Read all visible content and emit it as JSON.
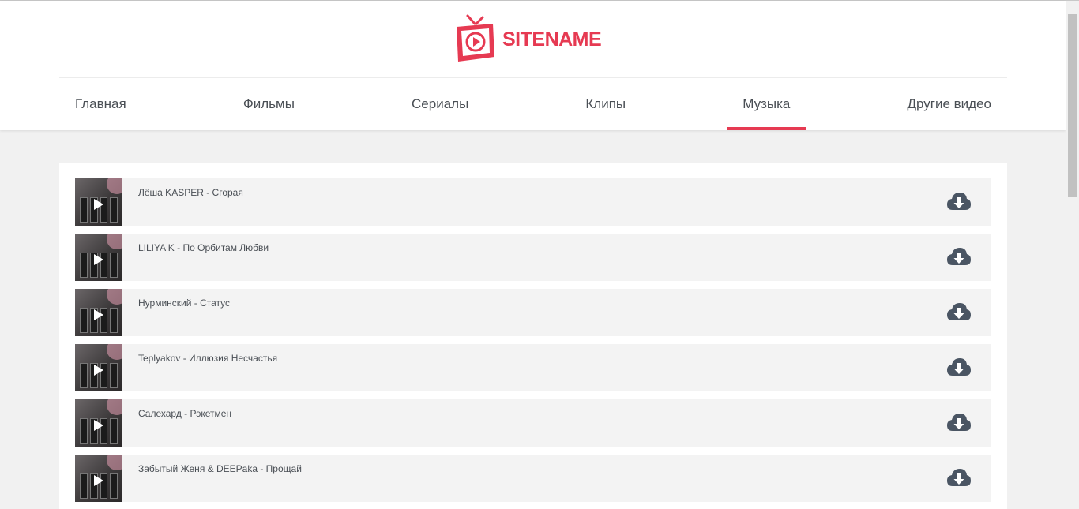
{
  "site": {
    "name": "SITENAME",
    "brand_color": "#e63a52"
  },
  "nav": {
    "items": [
      {
        "label": "Главная",
        "active": false
      },
      {
        "label": "Фильмы",
        "active": false
      },
      {
        "label": "Сериалы",
        "active": false
      },
      {
        "label": "Клипы",
        "active": false
      },
      {
        "label": "Музыка",
        "active": true
      },
      {
        "label": "Другие видео",
        "active": false
      }
    ]
  },
  "tracks": [
    {
      "title": "Лёша KASPER - Сгорая",
      "thumb_icon": "play-icon",
      "action_icon": "cloud-download-icon"
    },
    {
      "title": "LILIYA K - По Орбитам Любви",
      "thumb_icon": "play-icon",
      "action_icon": "cloud-download-icon"
    },
    {
      "title": "Нурминский - Статус",
      "thumb_icon": "play-icon",
      "action_icon": "cloud-download-icon"
    },
    {
      "title": "Teplyakov - Иллюзия Несчастья",
      "thumb_icon": "play-icon",
      "action_icon": "cloud-download-icon"
    },
    {
      "title": "Салехард - Рэкетмен",
      "thumb_icon": "play-icon",
      "action_icon": "cloud-download-icon"
    },
    {
      "title": "Забытый Женя & DEEPaka - Прощай",
      "thumb_icon": "play-icon",
      "action_icon": "cloud-download-icon"
    }
  ]
}
